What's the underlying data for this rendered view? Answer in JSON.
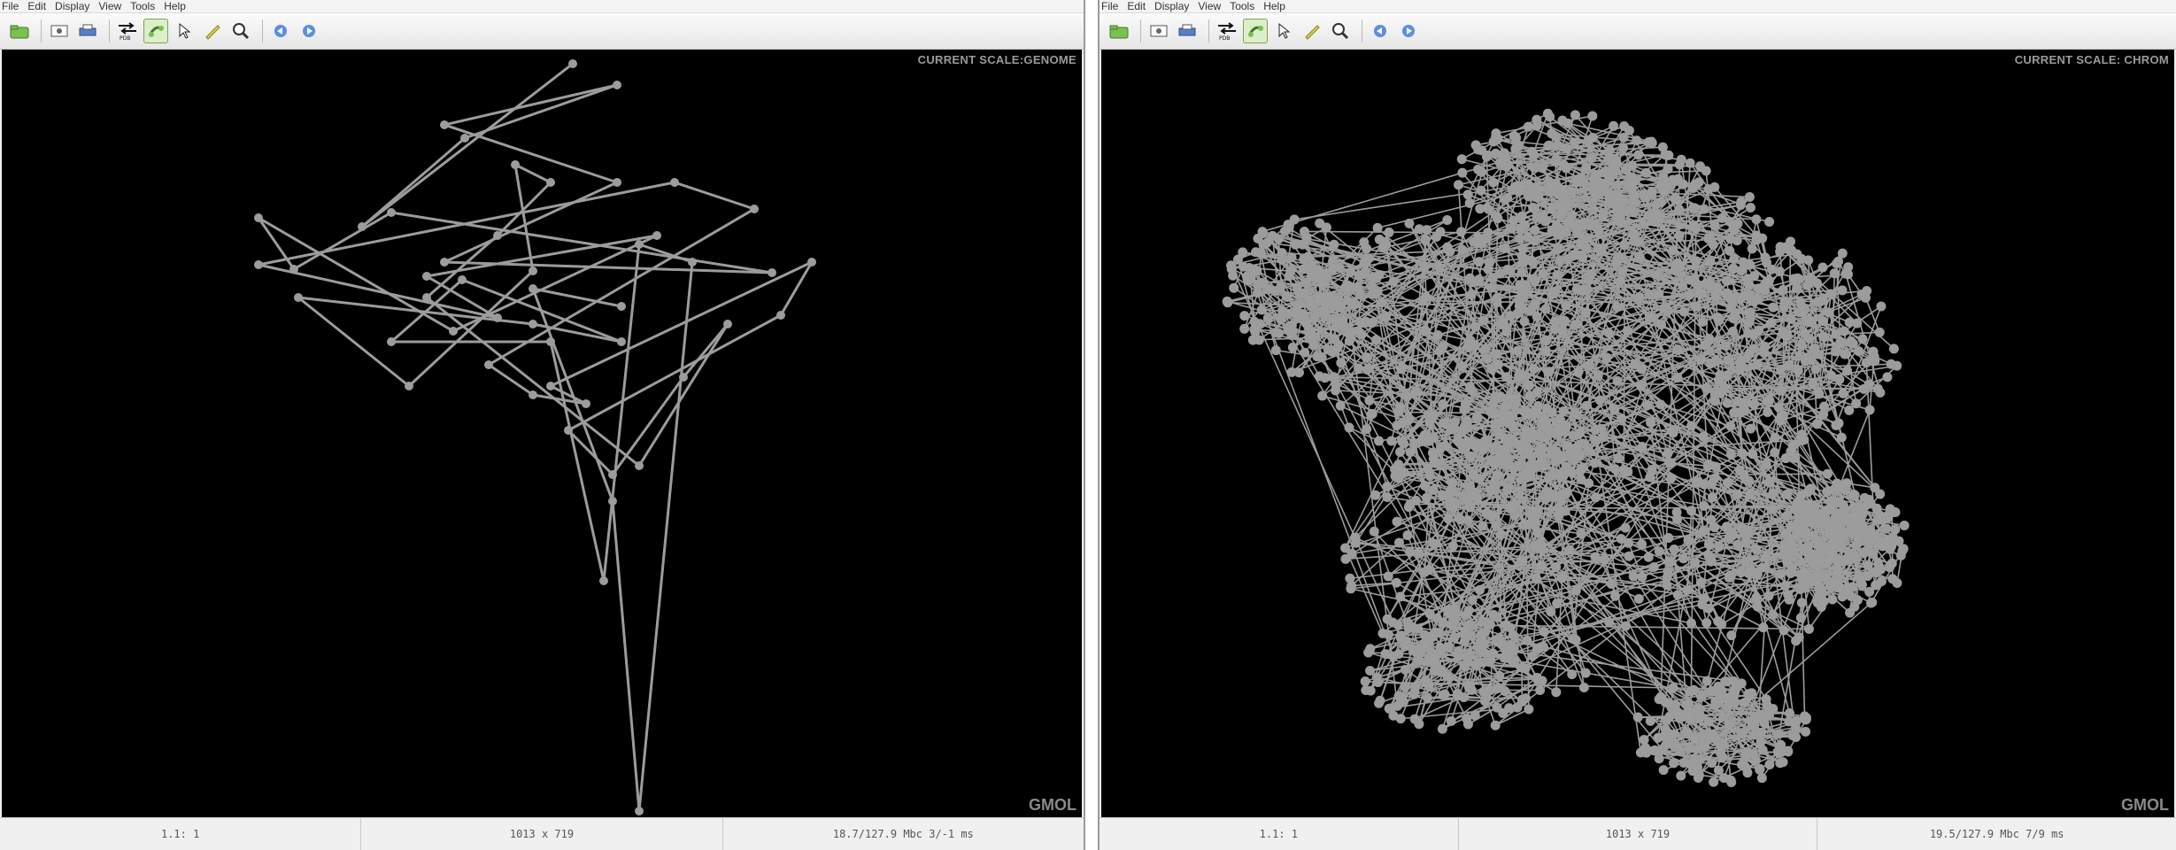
{
  "left": {
    "menu": [
      "File",
      "Edit",
      "Display",
      "View",
      "Tools",
      "Help"
    ],
    "scale_label": "CURRENT SCALE:GENOME",
    "logo": "GMOL",
    "status": {
      "zoom": "1.1: 1",
      "resolution": "1013 x 719",
      "memory": "18.7/127.9 Mbc   3/-1 ms"
    }
  },
  "right": {
    "menu": [
      "File",
      "Edit",
      "Display",
      "View",
      "Tools",
      "Help"
    ],
    "scale_label": "CURRENT SCALE: CHROM",
    "logo": "GMOL",
    "status": {
      "zoom": "1.1: 1",
      "resolution": "1013 x 719",
      "memory": "19.5/127.9 Mbc   7/9 ms"
    }
  },
  "toolbar_icons": [
    "open-icon",
    "screenshot-icon",
    "print-icon",
    "pdb-icon",
    "sync-icon",
    "pointer-icon",
    "ruler-icon",
    "magnify-icon",
    "eye-left-icon",
    "eye-right-icon"
  ],
  "colors": {
    "viewport_bg": "#000000",
    "model": "#9c9c9c",
    "active_tool": "#dcefc8"
  }
}
